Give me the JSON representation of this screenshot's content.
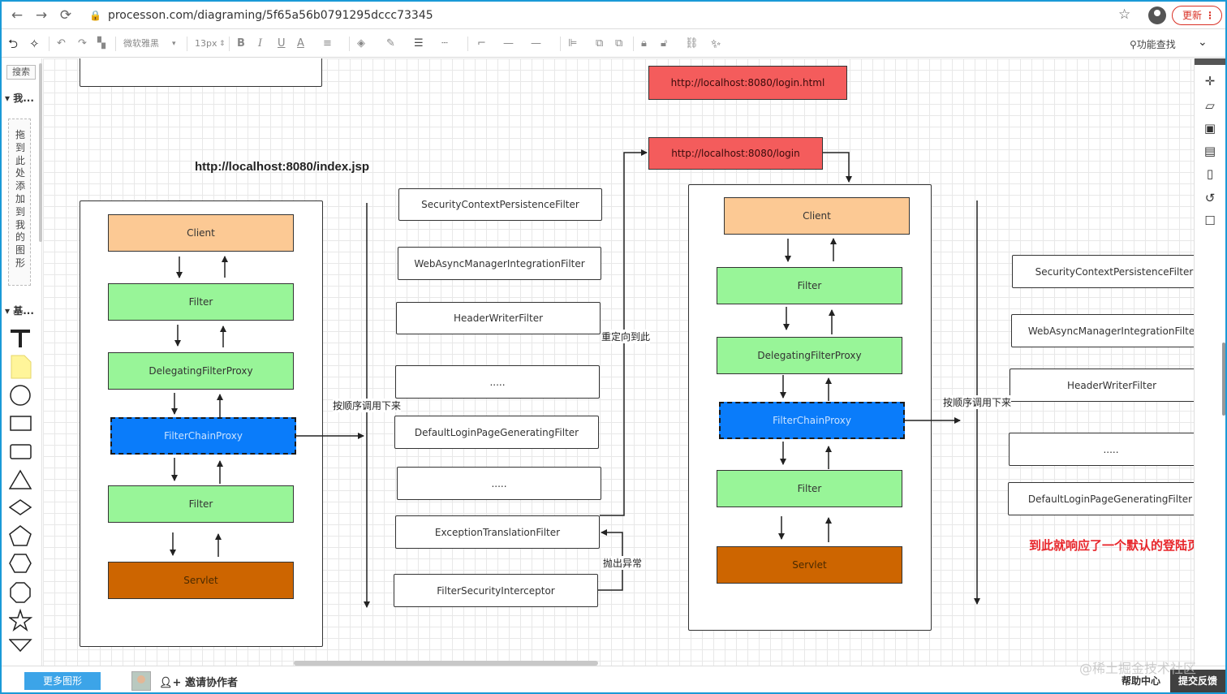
{
  "browser": {
    "url": "processon.com/diagraming/5f65a56b0791295dccc73345",
    "update_label": "更新",
    "update_menu": "⋮",
    "back": "←",
    "forward": "→",
    "reload": "⟳",
    "bookmark": "☆"
  },
  "toolbar": {
    "font_family": "微软雅黑",
    "font_size": "13px",
    "bold": "B",
    "italic": "I",
    "underline": "U",
    "font_color": "A",
    "func_search": "功能查找",
    "collapse": "»"
  },
  "left_panel": {
    "search": "搜索",
    "my_group": "我...",
    "drag_hint": "拖到此处添加到我的图形",
    "basic_group": "基..."
  },
  "bottom_bar": {
    "more_shapes": "更多图形",
    "invite": "邀请协作者",
    "help": "帮助中心",
    "feedback": "提交反馈",
    "watermark": "@稀土掘金技术社区"
  },
  "diagram": {
    "left_title": "http://localhost:8080/index.jsp",
    "left_stack": {
      "client": "Client",
      "filter1": "Filter",
      "dfp": "DelegatingFilterProxy",
      "fcp": "FilterChainProxy",
      "filter2": "Filter",
      "servlet": "Servlet"
    },
    "middle_filters": [
      "SecurityContextPersistenceFilter",
      "WebAsyncManagerIntegrationFilter",
      "HeaderWriterFilter",
      ".....",
      "DefaultLoginPageGeneratingFilter",
      ".....",
      "ExceptionTranslationFilter",
      "FilterSecurityInterceptor"
    ],
    "label_order_left": "按顺序调用下来",
    "label_redirect": "重定向到此",
    "label_throw": "抛出异常",
    "url_login_html": "http://localhost:8080/login.html",
    "url_login": "http://localhost:8080/login",
    "right_stack": {
      "client": "Client",
      "filter1": "Filter",
      "dfp": "DelegatingFilterProxy",
      "fcp": "FilterChainProxy",
      "filter2": "Filter",
      "servlet": "Servlet"
    },
    "label_order_right": "按顺序调用下来",
    "right_filters": [
      "SecurityContextPersistenceFilter",
      "WebAsyncManagerIntegrationFilter",
      "HeaderWriterFilter",
      ".....",
      "DefaultLoginPageGeneratingFilter"
    ],
    "note_red": "到此就响应了一个默认的登陆页面",
    "note_red_color": "#e8262b"
  }
}
